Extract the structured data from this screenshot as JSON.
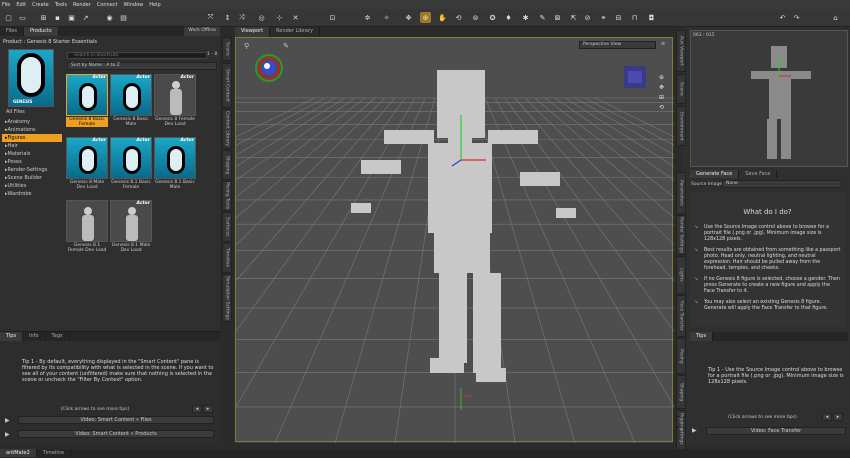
{
  "menu": [
    "File",
    "Edit",
    "Create",
    "Tools",
    "Render",
    "Connect",
    "Window",
    "Help"
  ],
  "left": {
    "tabs": [
      "Files",
      "Products"
    ],
    "world_offline": "Work Offline",
    "product_title": "Product : Genesis 8 Starter Essentials",
    "all_files": "All Files",
    "search_placeholder": "Search in Shortcuts",
    "page_info": "1 - 8",
    "sort": "Sort by Name : A to Z",
    "categories": [
      "Anatomy",
      "Animations",
      "Figures",
      "Hair",
      "Materials",
      "Poses",
      "Render-Settings",
      "Scene Builder",
      "Utilities",
      "Wardrobe"
    ],
    "cards": [
      {
        "label": "Genesis 8 Basic Female",
        "actor": "Actor",
        "type": "logo",
        "selected": true
      },
      {
        "label": "Genesis 8 Basic Male",
        "actor": "Actor",
        "type": "logo"
      },
      {
        "label": "Genesis 8 Female Dev Load",
        "actor": "Actor",
        "type": "figure"
      },
      {
        "label": "Genesis 8 Male Dev Load",
        "actor": "Actor",
        "type": "logo"
      },
      {
        "label": "Genesis 8.1 Basic Female",
        "actor": "Actor",
        "type": "logo"
      },
      {
        "label": "Genesis 8.1 Basic Male",
        "actor": "Actor",
        "type": "logo"
      },
      {
        "label": "Genesis 8.1 Female Dev Load",
        "actor": "",
        "type": "figure"
      },
      {
        "label": "Genesis 8.1 Male Dev Load",
        "actor": "Actor",
        "type": "figure"
      }
    ],
    "vtabs": [
      "Smart Content",
      "Content Library",
      "Shaping",
      "Posing Tools",
      "Surfaces",
      "Timeline",
      "Simulation Settings"
    ],
    "vtab_top": "Scene",
    "tips_tabs": [
      "Tips",
      "Info",
      "Tags"
    ],
    "tip_text": "Tip 1 - By default, everything displayed in the \"Smart Content\" pane is filtered by its compatibility with what is selected in the scene. If you want to see all of your content (unfiltered) make sure that nothing is selected in the scene or uncheck the \"Filter By Context\" option.",
    "tip_nav": "(Click arrows to see more tips)",
    "video1": "Video: Smart Content » Files",
    "video2": "Video: Smart Content » Products"
  },
  "viewport": {
    "tabs": [
      "Viewport",
      "Render Library"
    ],
    "view_mode": "Perspective View"
  },
  "right": {
    "aux_header": "Aux Viewport",
    "aux_coords": "063 : 015",
    "vtabs_top": [
      "Aux Viewport",
      "Scene",
      "Environment"
    ],
    "vtabs_mid": [
      "Parameters",
      "Render Settings",
      "Lights",
      "Face Transfer",
      "Posing",
      "Shaping",
      "Tool Settings"
    ],
    "face_tabs": [
      "Generate Face",
      "Save Face"
    ],
    "source_label": "Source Image:",
    "source_value": "None",
    "heading": "What do I do?",
    "steps": [
      "Use the Source Image control above to browse for a portrait file (.png or .jpg). Minimum image size is 128x128 pixels.",
      "Best results are obtained from something like a passport photo. Head only, neutral lighting, and neutral expression. Hair should be pulled away from the forehead, temples, and cheeks.",
      "If no Genesis 8 figure is selected, choose a gender. Then press Generate to create a new figure and apply the Face Transfer to it.",
      "You may also select an existing Genesis 8 figure. Generate will apply the Face Transfer to that figure."
    ],
    "tips_tab": "Tips",
    "tip_text": "Tip 1 - Use the Source Image control above to browse for a portrait file (.png or .jpg). Minimum image size is 128x128 pixels.",
    "tip_nav": "(Click arrows to see more tips)",
    "video": "Video: Face Transfer",
    "bottom_vtab": "Rigging"
  },
  "status": {
    "tabs": [
      "antMate2",
      "Timeline"
    ]
  }
}
